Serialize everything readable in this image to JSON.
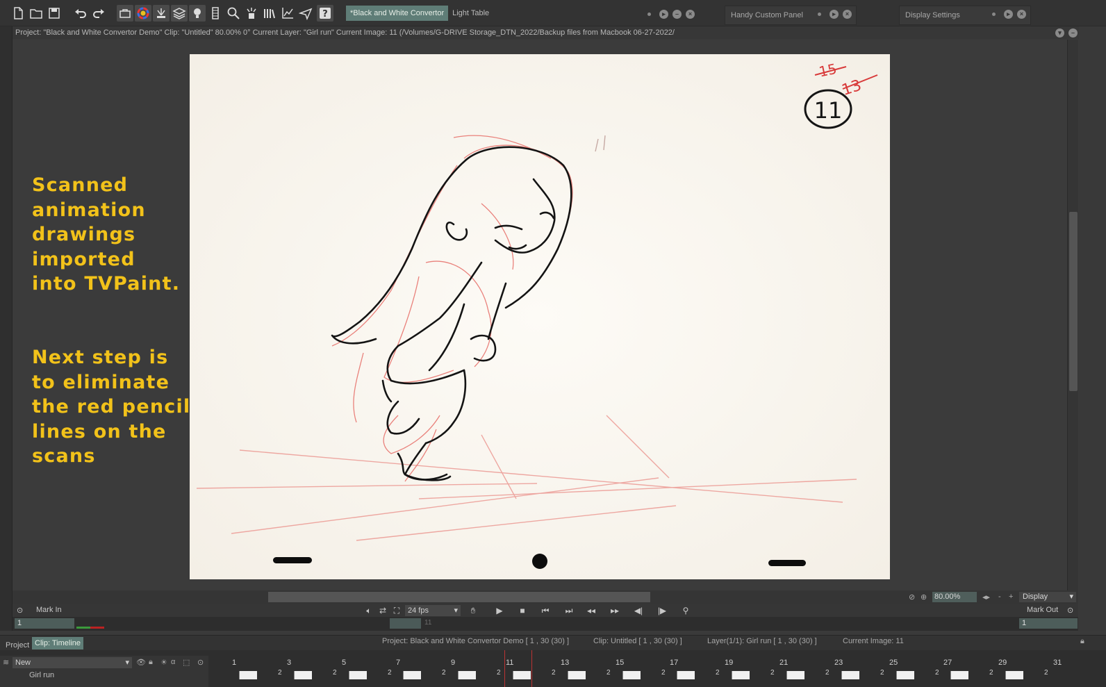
{
  "window": {
    "tabs": [
      {
        "label": "*Black and White Convertor",
        "active": true
      },
      {
        "label": "Light Table",
        "active": false
      }
    ],
    "panels": [
      "Handy Custom Panel",
      "Display Settings"
    ]
  },
  "toolbar": {
    "icons": [
      "new-file-icon",
      "open-file-icon",
      "save-icon",
      "undo-icon",
      "redo-icon",
      "toolbox-icon",
      "color-wheel-icon",
      "brush-panel-icon",
      "layers-icon",
      "light-table-icon",
      "timeline-icon",
      "search-icon",
      "fx-icon",
      "library-icon",
      "chart-icon",
      "send-icon",
      "help-icon"
    ]
  },
  "infobar": {
    "text": "Project:  \"Black and White Convertor Demo\"  Clip: \"Untitled\"   80.00%   0°  Current Layer: \"Girl run\"  Current Image: 11 (/Volumes/G-DRIVE Storage_DTN_2022/Backup files from Macbook 06-27-2022/"
  },
  "caption": {
    "line1": "Scanned\nanimation\ndrawings\nimported\ninto TVPaint.",
    "line2": "Next step is\nto eliminate\nthe red pencil\nlines on the\nscans"
  },
  "drawing": {
    "frame_mark_primary": "11",
    "frame_mark_secondary": "13",
    "frame_mark_crossed": "15"
  },
  "view": {
    "zoom": "80.00%",
    "display": "Display",
    "zoom_minus": "-",
    "zoom_plus": "+"
  },
  "transport": {
    "mark_in": "Mark In",
    "mark_out": "Mark Out",
    "fps": "24 fps",
    "in_value": "1",
    "out_value": "1",
    "current_frame_ghost": "11"
  },
  "projectbar": {
    "tab_project": "Project",
    "tab_timeline": "Clip: Timeline",
    "status_project": "Project: Black and White Convertor Demo [ 1 , 30  (30) ]",
    "status_clip": "Clip: Untitled [ 1 , 30  (30) ]",
    "status_layer": "Layer(1/1): Girl run [ 1 , 30  (30) ]",
    "status_image": "Current Image: 11"
  },
  "timeline": {
    "new_layer": "New",
    "layer_name": "Girl run",
    "frame_numbers": [
      "1",
      "3",
      "5",
      "7",
      "9",
      "11",
      "13",
      "15",
      "17",
      "19",
      "21",
      "23",
      "25",
      "27",
      "29",
      "31"
    ],
    "cell_hold": "2",
    "current_frame": "11"
  }
}
